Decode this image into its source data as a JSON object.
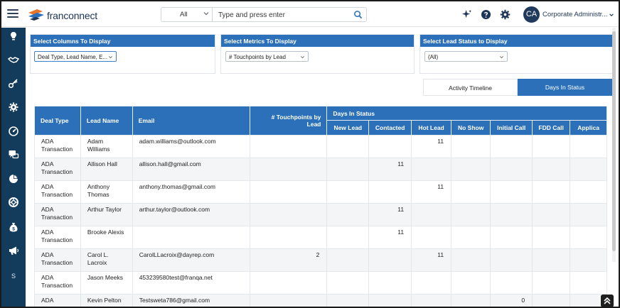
{
  "header": {
    "logo_text": "franconnect",
    "search": {
      "scope": "All",
      "placeholder": "Type and press enter"
    },
    "user": {
      "initials": "CA",
      "name": "Corporate Administr..."
    }
  },
  "sidebar": {
    "items": [
      {
        "icon": "lightbulb-icon"
      },
      {
        "icon": "handshake-icon"
      },
      {
        "icon": "key-icon"
      },
      {
        "icon": "gear-icon"
      },
      {
        "icon": "speedometer-icon"
      },
      {
        "icon": "chat-icon"
      },
      {
        "icon": "pie-chart-icon"
      },
      {
        "icon": "lifebuoy-icon"
      },
      {
        "icon": "money-bag-icon"
      },
      {
        "icon": "megaphone-icon"
      }
    ],
    "letter_item": "S"
  },
  "filters": {
    "columns": {
      "title": "Select Columns To Display",
      "value": "Deal Type, Lead Name, E..."
    },
    "metrics": {
      "title": "Select Metrics To Display",
      "value": "# Touchpoints by Lead"
    },
    "status": {
      "title": "Select Lead Status to Display",
      "value": "(All)"
    }
  },
  "tabs": {
    "activity": "Activity Timeline",
    "days": "Days In Status"
  },
  "table": {
    "headers": {
      "deal_type": "Deal Type",
      "lead_name": "Lead Name",
      "email": "Email",
      "touchpoints": "# Touchpoints by Lead",
      "days_group": "Days In Status",
      "sub": [
        "New Lead",
        "Contacted",
        "Hot Lead",
        "No Show",
        "Initial Call",
        "FDD Call",
        "Applica"
      ]
    },
    "rows": [
      {
        "deal": "ADA Transaction",
        "lead": "Adam Williams",
        "email": "adam.williams@outlook.com",
        "tp": "",
        "days": [
          "",
          "",
          "11",
          "",
          "",
          "",
          ""
        ]
      },
      {
        "deal": "ADA Transaction",
        "lead": "Allison Hall",
        "email": "allison.hall@gmail.com",
        "tp": "",
        "days": [
          "",
          "11",
          "",
          "",
          "",
          "",
          ""
        ]
      },
      {
        "deal": "ADA Transaction",
        "lead": "Anthony Thomas",
        "email": "anthony.thomas@gmail.com",
        "tp": "",
        "days": [
          "",
          "",
          "11",
          "",
          "",
          "",
          ""
        ]
      },
      {
        "deal": "ADA Transaction",
        "lead": "Arthur Taylor",
        "email": "arthur.taylor@outlook.com",
        "tp": "",
        "days": [
          "",
          "11",
          "",
          "",
          "",
          "",
          ""
        ]
      },
      {
        "deal": "ADA Transaction",
        "lead": "Brooke Alexis",
        "email": "",
        "tp": "",
        "days": [
          "",
          "11",
          "",
          "",
          "",
          "",
          ""
        ]
      },
      {
        "deal": "ADA Transaction",
        "lead": "Carol L. Lacroix",
        "email": "CarolLLacroix@dayrep.com",
        "tp": "2",
        "days": [
          "",
          "",
          "11",
          "",
          "",
          "",
          ""
        ]
      },
      {
        "deal": "ADA Transaction",
        "lead": "Jason Meeks",
        "email": "453239580test@franqa.net",
        "tp": "",
        "days": [
          "",
          "",
          "",
          "",
          "",
          "",
          ""
        ]
      },
      {
        "deal": "ADA",
        "lead": "Kevin Pelton",
        "email": "Testsweta786@gmail.com",
        "tp": "",
        "days": [
          "",
          "",
          "",
          "",
          "0",
          "",
          ""
        ]
      }
    ]
  },
  "colors": {
    "primary": "#2b70b8",
    "sidebar": "#123b5c",
    "brand_orange": "#e8742a"
  }
}
